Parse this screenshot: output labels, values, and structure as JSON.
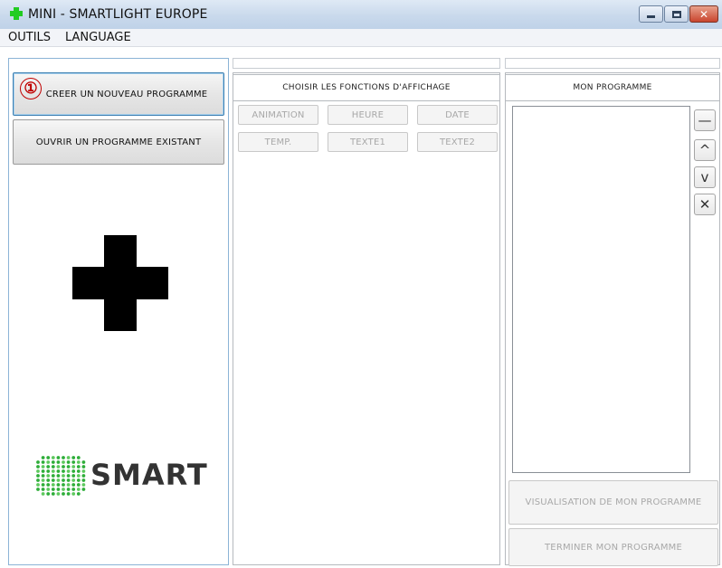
{
  "window": {
    "title": "MINI  - SMARTLIGHT EUROPE",
    "minimize_glyph": "",
    "close_glyph": "✕"
  },
  "menu": {
    "items": [
      "OUTILS",
      "LANGUAGE"
    ]
  },
  "left_panel": {
    "create_button": "CREER UN NOUVEAU PROGRAMME",
    "open_button": "OUVRIR UN PROGRAMME EXISTANT",
    "step_marker": "①",
    "logo_text": "SMART",
    "logo_icon": "green-dot-grid-icon",
    "plus_icon": "black-cross-icon"
  },
  "middle_panel": {
    "header": "CHOISIR LES FONCTIONS D'AFFICHAGE",
    "functions": [
      [
        "ANIMATION",
        "HEURE",
        "DATE"
      ],
      [
        "TEMP.",
        "TEXTE1",
        "TEXTE2"
      ]
    ]
  },
  "right_panel": {
    "header": "MON PROGRAMME",
    "side_buttons": [
      {
        "name": "remove-dash",
        "glyph": "—"
      },
      {
        "name": "move-up",
        "glyph": "^"
      },
      {
        "name": "move-down",
        "glyph": "v"
      },
      {
        "name": "delete",
        "glyph": "✕"
      }
    ],
    "preview_button": "VISUALISATION DE MON PROGRAMME",
    "finish_button": "TERMINER MON PROGRAMME"
  },
  "colors": {
    "accent_green": "#22cc22",
    "marker_red": "#c00000",
    "panel_border": "#8cb4d6"
  }
}
